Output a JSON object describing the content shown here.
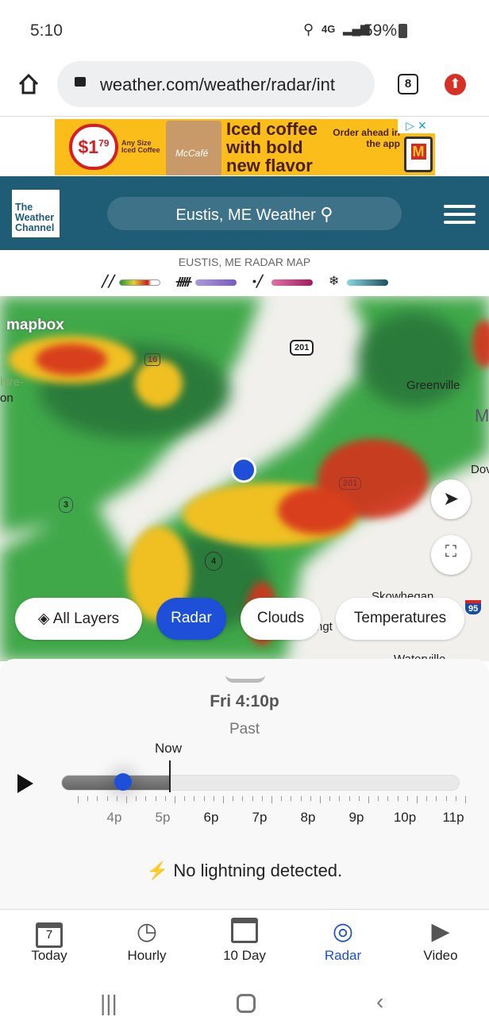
{
  "status": {
    "time": "5:10",
    "network": "4G",
    "battery": "59%"
  },
  "browser": {
    "url": "weather.com/weather/radar/int",
    "tab_count": "8"
  },
  "ad": {
    "price": "$1.79",
    "price_dollar": "$1",
    "price_cents": "79",
    "sub": "Any Size Iced Coffee",
    "headline1": "Iced coffee",
    "headline2": "with bold",
    "headline3": "new flavor",
    "cta": "Order ahead in the app",
    "brand": "McCafé"
  },
  "header": {
    "logo": "The Weather Channel",
    "search": "Eustis, ME Weather"
  },
  "legend": {
    "title": "EUSTIS, ME RADAR MAP",
    "items": [
      {
        "icon": "rain-icon",
        "colors": [
          "#1a9a2a",
          "#e8d02a",
          "#d21a12",
          "#ffffff"
        ]
      },
      {
        "icon": "ice-icon",
        "colors": [
          "#a99ad8",
          "#7a5cc0"
        ]
      },
      {
        "icon": "mix-icon",
        "colors": [
          "#e070a8",
          "#a01c5c"
        ]
      },
      {
        "icon": "snow-icon",
        "colors": [
          "#86d8e0",
          "#1f4f5e"
        ]
      }
    ]
  },
  "map": {
    "attribution": "mapbox",
    "labels": {
      "greenville": "Greenville",
      "dover": "Dov",
      "skowhegan": "Skowhegan",
      "farmington": "ngt",
      "partial_left1": "hire-",
      "partial_left2": "on",
      "m": "M",
      "waterville": "Waterville"
    },
    "routes": [
      "201",
      "16",
      "3",
      "4",
      "201",
      "95"
    ]
  },
  "layers": {
    "all": "All Layers",
    "radar": "Radar",
    "clouds": "Clouds",
    "temps": "Temperatures",
    "active": "Radar"
  },
  "timeline": {
    "time": "Fri 4:10p",
    "state": "Past",
    "now": "Now",
    "labels": [
      "4p",
      "5p",
      "6p",
      "7p",
      "8p",
      "9p",
      "10p",
      "11p"
    ],
    "progress": 0.16
  },
  "lightning": "No lightning detected.",
  "nav": [
    {
      "label": "Today",
      "day": "7"
    },
    {
      "label": "Hourly"
    },
    {
      "label": "10 Day"
    },
    {
      "label": "Radar"
    },
    {
      "label": "Video"
    }
  ],
  "colors": {
    "accent": "#1d4fd8",
    "header": "#1f5c76"
  }
}
